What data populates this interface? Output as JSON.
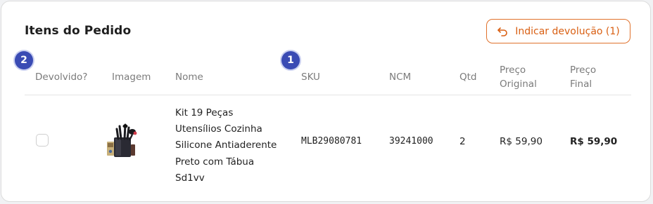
{
  "card": {
    "title": "Itens do Pedido"
  },
  "return_button": {
    "label": "Indicar devolução (1)",
    "icon": "undo-arrow-icon",
    "color": "#e0712b"
  },
  "badges": {
    "badge_1": "1",
    "badge_2": "2",
    "color": "#3a4bb4"
  },
  "table": {
    "columns": {
      "returned": "Devolvido?",
      "image": "Imagem",
      "name": "Nome",
      "sku": "SKU",
      "ncm": "NCM",
      "qty": "Qtd",
      "original_price_l1": "Preço",
      "original_price_l2": "Original",
      "final_price_l1": "Preço",
      "final_price_l2": "Final"
    },
    "rows": [
      {
        "returned": false,
        "image_icon": "kitchen-utensil-set-product-image",
        "name": "Kit 19 Peças Utensílios Cozinha Silicone Antiaderente Preto com Tábua Sd1vv",
        "sku": "MLB29080781",
        "ncm": "39241000",
        "qty": "2",
        "original_price": "R$ 59,90",
        "final_price": "R$ 59,90"
      }
    ]
  }
}
